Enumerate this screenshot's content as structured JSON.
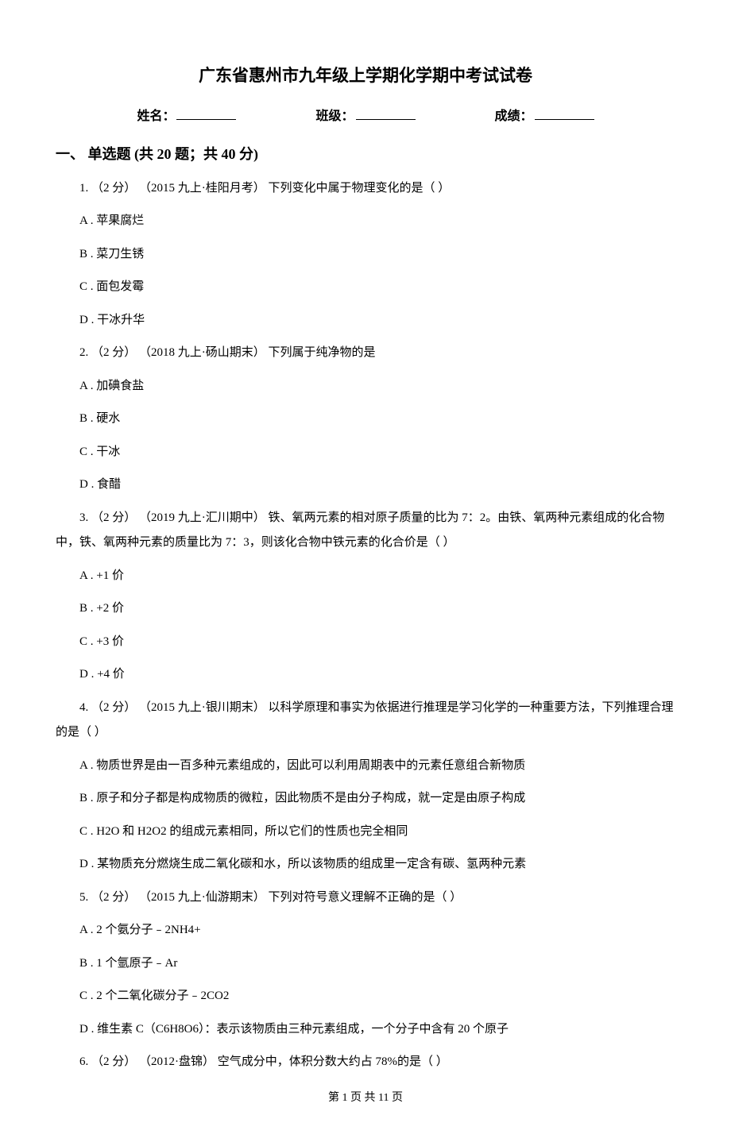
{
  "title": "广东省惠州市九年级上学期化学期中考试试卷",
  "info": {
    "name_label": "姓名：",
    "class_label": "班级：",
    "score_label": "成绩："
  },
  "section1": {
    "header": "一、 单选题 (共 20 题；共 40 分)"
  },
  "q1": {
    "stem": "1.  （2 分） （2015 九上·桂阳月考） 下列变化中属于物理变化的是（     ）",
    "A": "A .  苹果腐烂",
    "B": "B .  菜刀生锈",
    "C": "C .  面包发霉",
    "D": "D .  干冰升华"
  },
  "q2": {
    "stem": "2.  （2 分） （2018 九上·砀山期末） 下列属于纯净物的是",
    "A": "A .  加碘食盐",
    "B": "B .  硬水",
    "C": "C .  干冰",
    "D": "D .  食醋"
  },
  "q3": {
    "stem": "3.  （2 分） （2019 九上·汇川期中） 铁、氧两元素的相对原子质量的比为 7：2。由铁、氧两种元素组成的化合物中，铁、氧两种元素的质量比为 7：3，则该化合物中铁元素的化合价是（     ）",
    "A": "A .  +1 价",
    "B": "B .  +2 价",
    "C": "C .  +3 价",
    "D": "D .  +4 价"
  },
  "q4": {
    "stem": "4.  （2 分） （2015 九上·银川期末） 以科学原理和事实为依据进行推理是学习化学的一种重要方法，下列推理合理的是（     ）",
    "A": "A .  物质世界是由一百多种元素组成的，因此可以利用周期表中的元素任意组合新物质",
    "B": "B .  原子和分子都是构成物质的微粒，因此物质不是由分子构成，就一定是由原子构成",
    "C": "C .  H2O 和 H2O2 的组成元素相同，所以它们的性质也完全相同",
    "D": "D .  某物质充分燃烧生成二氧化碳和水，所以该物质的组成里一定含有碳、氢两种元素"
  },
  "q5": {
    "stem": "5.  （2 分） （2015 九上·仙游期末） 下列对符号意义理解不正确的是（     ）",
    "A": "A .  2 个氨分子﹣2NH4+",
    "B": "B .  1 个氩原子﹣Ar",
    "C": "C .  2 个二氧化碳分子﹣2CO2",
    "D": "D .  维生素 C（C6H8O6）：表示该物质由三种元素组成，一个分子中含有 20 个原子"
  },
  "q6": {
    "stem": "6.  （2 分） （2012·盘锦） 空气成分中，体积分数大约占 78%的是（     ）"
  },
  "footer": "第 1 页 共 11 页"
}
